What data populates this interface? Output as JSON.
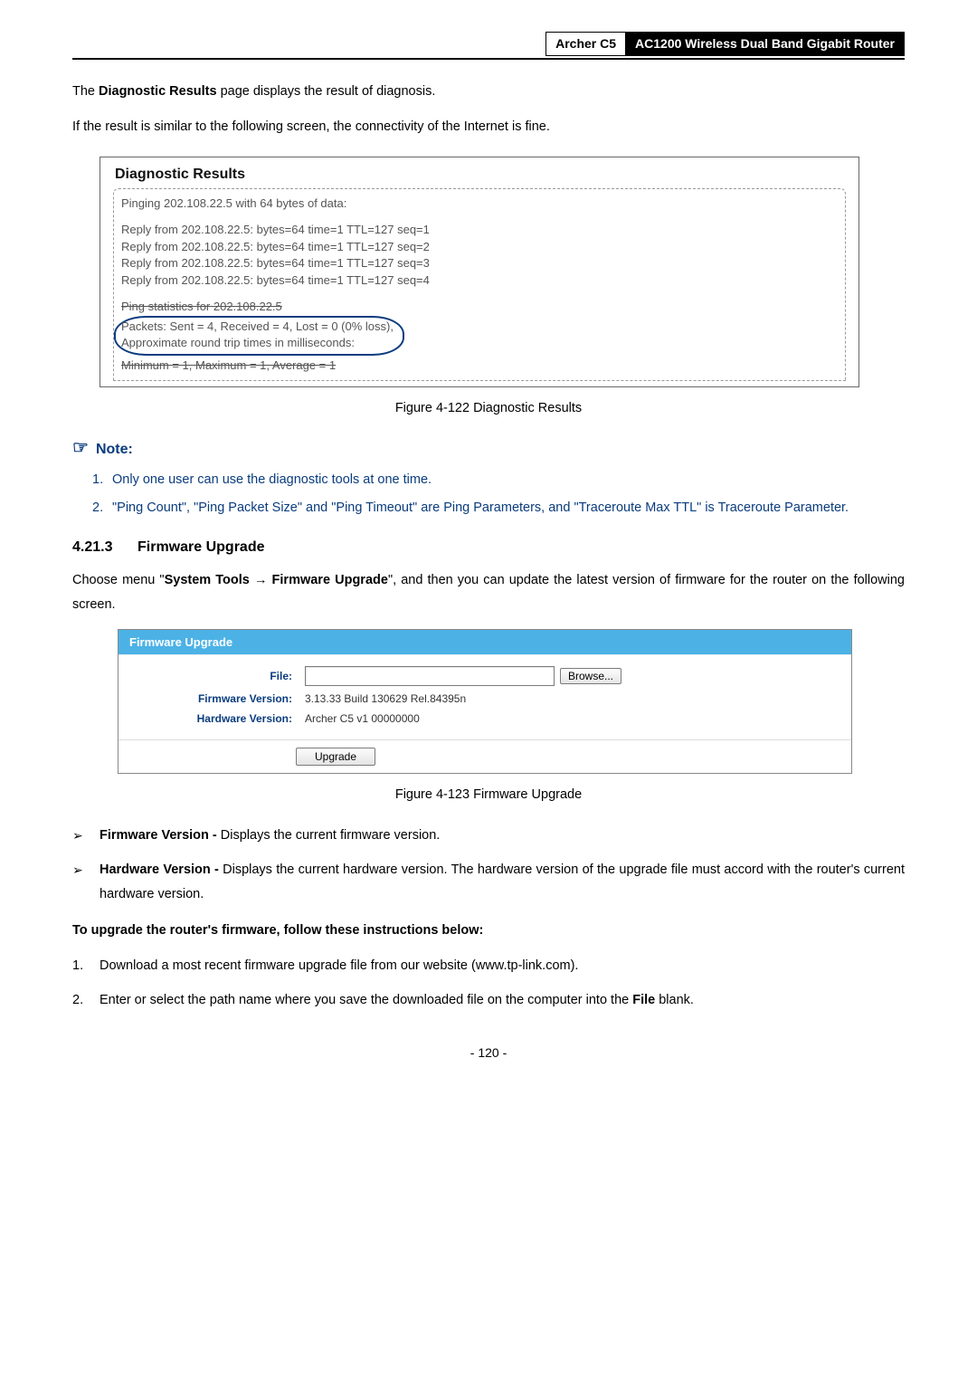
{
  "header": {
    "model": "Archer C5",
    "desc": "AC1200 Wireless Dual Band Gigabit Router"
  },
  "intro1_pre": "The ",
  "intro1_bold": "Diagnostic Results",
  "intro1_post": " page displays the result of diagnosis.",
  "intro2": "If the result is similar to the following screen, the connectivity of the Internet is fine.",
  "diag": {
    "title": "Diagnostic Results",
    "l0": "Pinging 202.108.22.5 with 64 bytes of data:",
    "l1": "Reply from 202.108.22.5:  bytes=64  time=1  TTL=127  seq=1",
    "l2": "Reply from 202.108.22.5:  bytes=64  time=1  TTL=127  seq=2",
    "l3": "Reply from 202.108.22.5:  bytes=64  time=1  TTL=127  seq=3",
    "l4": "Reply from 202.108.22.5:  bytes=64  time=1  TTL=127  seq=4",
    "s1": "Ping statistics for 202.108.22.5",
    "c1": "  Packets: Sent = 4, Received = 4, Lost = 0 (0% loss),",
    "c2": "Approximate round trip times in milliseconds:",
    "s2": "  Minimum = 1, Maximum = 1, Average = 1"
  },
  "fig122": "Figure 4-122 Diagnostic Results",
  "note_label": "Note:",
  "note1": "Only one user can use the diagnostic tools at one time.",
  "note2": "\"Ping Count\", \"Ping Packet Size\" and \"Ping Timeout\" are Ping Parameters, and \"Traceroute Max TTL\" is Traceroute Parameter.",
  "section_num": "4.21.3",
  "section_title": "Firmware Upgrade",
  "fw_para_a": "Choose menu \"",
  "fw_para_b": "System Tools",
  "fw_para_arrow": " → ",
  "fw_para_c": "Firmware Upgrade",
  "fw_para_d": "\", and then you can update the latest version of firmware for the router on the following screen.",
  "fwbox": {
    "head": "Firmware Upgrade",
    "file_label": "File:",
    "browse": "Browse...",
    "fwv_label": "Firmware Version:",
    "fwv_val": "3.13.33 Build 130629 Rel.84395n",
    "hwv_label": "Hardware Version:",
    "hwv_val": "Archer C5 v1 00000000",
    "upgrade": "Upgrade"
  },
  "fig123": "Figure 4-123 Firmware Upgrade",
  "b1_bold": "Firmware Version -",
  "b1_rest": " Displays the current firmware version.",
  "b2_bold": "Hardware Version -",
  "b2_rest": " Displays the current hardware version. The hardware version of the upgrade file must accord with the router's current hardware version.",
  "instr_head": "To upgrade the router's firmware, follow these instructions below:",
  "step1": "Download a most recent firmware upgrade file from our website (www.tp-link.com).",
  "step2a": "Enter or select the path name where you save the downloaded file on the computer into the ",
  "step2b": "File",
  "step2c": " blank.",
  "page_number": "- 120 -"
}
